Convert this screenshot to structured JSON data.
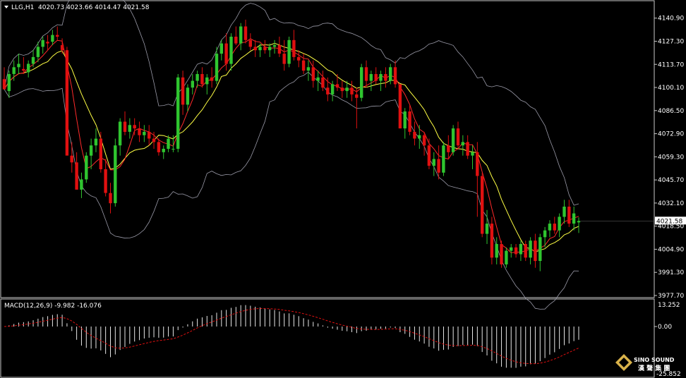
{
  "header": {
    "symbol": "LLG,H1",
    "ohlc": "4020.73 4023.66 4014.47 4021.58"
  },
  "macd": {
    "label": "MACD(12,26,9) -9.982 -16.076",
    "ticks": [
      "13.252",
      "0.00",
      "-25.852"
    ]
  },
  "price_badge": "4021.58",
  "logo": {
    "name": "SINO SOUND",
    "chinese": "漢 聲 集 團"
  },
  "colors": {
    "background": "#000000",
    "bull": "#2fc52f",
    "bear": "#e01010",
    "ma_fast": "#ff2a2a",
    "ma_slow": "#ffff44",
    "bollinger": "#9a9aa8",
    "macd_hist": "#e8e8e8",
    "macd_signal": "#e01010",
    "grid_line": "#c8c8c8"
  },
  "chart_data": [
    {
      "type": "candlestick",
      "title": "LLG,H1",
      "y_ticks": [
        "4140.90",
        "4127.30",
        "4113.70",
        "4100.10",
        "4086.50",
        "4072.90",
        "4059.30",
        "4045.70",
        "4032.10",
        "4018.50",
        "4004.90",
        "3991.30",
        "3977.70"
      ],
      "ylim": [
        3977.7,
        4147.0
      ],
      "candles": [
        [
          4105,
          4112,
          4100,
          4099
        ],
        [
          4098,
          4110,
          4094,
          4108
        ],
        [
          4108,
          4116,
          4104,
          4112
        ],
        [
          4112,
          4120,
          4108,
          4114
        ],
        [
          4111,
          4118,
          4108,
          4110
        ],
        [
          4109,
          4116,
          4106,
          4114
        ],
        [
          4114,
          4122,
          4112,
          4118
        ],
        [
          4118,
          4127,
          4115,
          4124
        ],
        [
          4124,
          4130,
          4120,
          4128
        ],
        [
          4127,
          4131,
          4122,
          4126
        ],
        [
          4127,
          4134,
          4125,
          4131
        ],
        [
          4131,
          4136,
          4128,
          4130
        ],
        [
          4125,
          4129,
          4120,
          4122
        ],
        [
          4122,
          4124,
          4060,
          4060
        ],
        [
          4060,
          4068,
          4050,
          4056
        ],
        [
          4056,
          4062,
          4040,
          4040
        ],
        [
          4040,
          4050,
          4035,
          4046
        ],
        [
          4046,
          4062,
          4044,
          4060
        ],
        [
          4060,
          4070,
          4052,
          4066
        ],
        [
          4066,
          4076,
          4062,
          4070
        ],
        [
          4070,
          4074,
          4050,
          4052
        ],
        [
          4052,
          4058,
          4036,
          4038
        ],
        [
          4038,
          4044,
          4026,
          4032
        ],
        [
          4032,
          4070,
          4030,
          4066
        ],
        [
          4066,
          4082,
          4060,
          4080
        ],
        [
          4080,
          4086,
          4072,
          4074
        ],
        [
          4074,
          4082,
          4070,
          4078
        ],
        [
          4078,
          4082,
          4072,
          4076
        ],
        [
          4076,
          4080,
          4068,
          4072
        ],
        [
          4072,
          4078,
          4068,
          4074
        ],
        [
          4074,
          4078,
          4066,
          4070
        ],
        [
          4070,
          4074,
          4064,
          4068
        ],
        [
          4068,
          4070,
          4060,
          4062
        ],
        [
          4062,
          4066,
          4058,
          4064
        ],
        [
          4064,
          4072,
          4062,
          4070
        ],
        [
          4064,
          4072,
          4062,
          4064
        ],
        [
          4064,
          4108,
          4062,
          4106
        ],
        [
          4106,
          4110,
          4084,
          4090
        ],
        [
          4090,
          4102,
          4086,
          4100
        ],
        [
          4100,
          4108,
          4096,
          4104
        ],
        [
          4104,
          4110,
          4100,
          4108
        ],
        [
          4108,
          4112,
          4100,
          4102
        ],
        [
          4102,
          4108,
          4096,
          4106
        ],
        [
          4106,
          4112,
          4100,
          4104
        ],
        [
          4104,
          4124,
          4102,
          4120
        ],
        [
          4120,
          4128,
          4116,
          4126
        ],
        [
          4126,
          4132,
          4110,
          4114
        ],
        [
          4114,
          4132,
          4110,
          4130
        ],
        [
          4130,
          4136,
          4125,
          4126
        ],
        [
          4126,
          4138,
          4122,
          4136
        ],
        [
          4136,
          4140,
          4126,
          4128
        ],
        [
          4128,
          4132,
          4122,
          4124
        ],
        [
          4124,
          4128,
          4118,
          4122
        ],
        [
          4122,
          4126,
          4118,
          4124
        ],
        [
          4124,
          4128,
          4120,
          4122
        ],
        [
          4122,
          4126,
          4118,
          4124
        ],
        [
          4124,
          4128,
          4120,
          4125
        ],
        [
          4125,
          4130,
          4118,
          4120
        ],
        [
          4120,
          4128,
          4110,
          4114
        ],
        [
          4114,
          4130,
          4112,
          4128
        ],
        [
          4128,
          4134,
          4116,
          4118
        ],
        [
          4118,
          4122,
          4112,
          4116
        ],
        [
          4116,
          4120,
          4108,
          4110
        ],
        [
          4110,
          4116,
          4104,
          4112
        ],
        [
          4112,
          4116,
          4100,
          4104
        ],
        [
          4104,
          4110,
          4098,
          4106
        ],
        [
          4106,
          4110,
          4098,
          4100
        ],
        [
          4100,
          4106,
          4092,
          4096
        ],
        [
          4096,
          4104,
          4092,
          4102
        ],
        [
          4102,
          4108,
          4098,
          4100
        ],
        [
          4100,
          4104,
          4094,
          4098
        ],
        [
          4098,
          4104,
          4094,
          4100
        ],
        [
          4100,
          4104,
          4092,
          4096
        ],
        [
          4096,
          4100,
          4076,
          4094
        ],
        [
          4094,
          4114,
          4092,
          4112
        ],
        [
          4112,
          4116,
          4100,
          4104
        ],
        [
          4104,
          4110,
          4098,
          4108
        ],
        [
          4108,
          4112,
          4102,
          4104
        ],
        [
          4104,
          4110,
          4098,
          4108
        ],
        [
          4108,
          4112,
          4100,
          4104
        ],
        [
          4104,
          4114,
          4102,
          4112
        ],
        [
          4112,
          4116,
          4100,
          4102
        ],
        [
          4102,
          4094,
          4076,
          4076
        ],
        [
          4076,
          4088,
          4070,
          4086
        ],
        [
          4086,
          4090,
          4072,
          4074
        ],
        [
          4074,
          4080,
          4066,
          4070
        ],
        [
          4070,
          4078,
          4064,
          4072
        ],
        [
          4072,
          4074,
          4060,
          4066
        ],
        [
          4066,
          4070,
          4052,
          4054
        ],
        [
          4054,
          4062,
          4048,
          4058
        ],
        [
          4058,
          4066,
          4046,
          4050
        ],
        [
          4050,
          4068,
          4048,
          4066
        ],
        [
          4066,
          4072,
          4058,
          4062
        ],
        [
          4062,
          4078,
          4060,
          4076
        ],
        [
          4076,
          4080,
          4064,
          4066
        ],
        [
          4066,
          4072,
          4060,
          4068
        ],
        [
          4068,
          4072,
          4058,
          4060
        ],
        [
          4060,
          4066,
          4052,
          4062
        ],
        [
          4062,
          4068,
          4024,
          4048
        ],
        [
          4048,
          4050,
          4012,
          4014
        ],
        [
          4014,
          4028,
          4008,
          4020
        ],
        [
          4020,
          4024,
          3996,
          4000
        ],
        [
          4000,
          4012,
          3996,
          4008
        ],
        [
          4008,
          4010,
          3994,
          3996
        ],
        [
          3996,
          4006,
          3994,
          4004
        ],
        [
          4004,
          4008,
          4000,
          4006
        ],
        [
          4006,
          4008,
          4000,
          4002
        ],
        [
          4002,
          4010,
          3998,
          4008
        ],
        [
          4008,
          4010,
          3998,
          4000
        ],
        [
          4000,
          4012,
          3996,
          4010
        ],
        [
          4010,
          4014,
          3994,
          3998
        ],
        [
          3998,
          4014,
          3992,
          4012
        ],
        [
          4012,
          4018,
          4006,
          4016
        ],
        [
          4016,
          4022,
          4012,
          4020
        ],
        [
          4020,
          4024,
          4014,
          4016
        ],
        [
          4016,
          4026,
          4012,
          4024
        ],
        [
          4024,
          4034,
          4020,
          4030
        ],
        [
          4030,
          4034,
          4018,
          4020
        ],
        [
          4020,
          4030,
          4016,
          4026
        ],
        [
          4020.73,
          4023.66,
          4014.47,
          4021.58
        ]
      ]
    },
    {
      "type": "bar",
      "title": "MACD(12,26,9)",
      "y_ticks": [
        "13.252",
        "0.00",
        "-25.852"
      ],
      "ylim": [
        -25.852,
        13.252
      ]
    }
  ]
}
